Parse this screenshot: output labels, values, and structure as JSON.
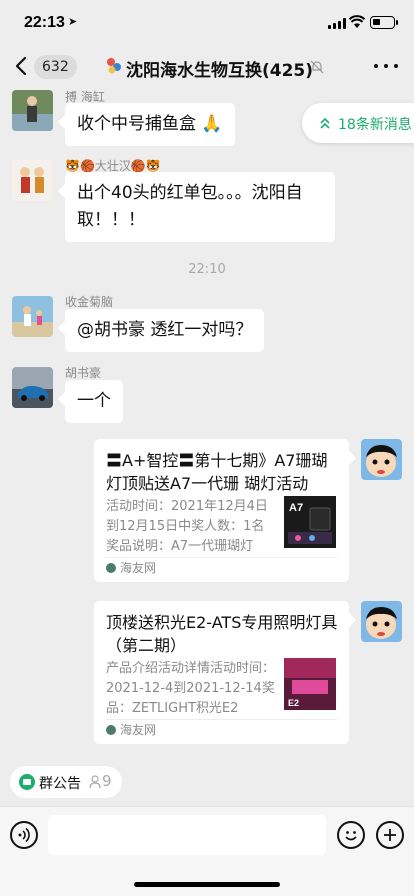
{
  "status": {
    "time": "22:13"
  },
  "nav": {
    "back_count": "632",
    "title": "沈阳海水生物互换(425)"
  },
  "new_messages": {
    "label": "18条新消息"
  },
  "messages": [
    {
      "sender": "搏 海缸",
      "text": "收个中号捕鱼盒 🙏"
    },
    {
      "sender": "🐯🏀大壮汉🏀🐯",
      "text": "出个40头的红单包。。。沈阳自取！！！"
    },
    {
      "sender": "收金菊脑",
      "text": "@胡书豪 透红一对吗？"
    },
    {
      "sender": "胡书豪",
      "text": "一个"
    }
  ],
  "time_divider": "22:10",
  "link_cards": [
    {
      "title": "〓A+智控〓第十七期》A7珊瑚灯顶贴送A7一代珊 瑚灯活动",
      "desc": "活动时间：2021年12月4日到12月15日中奖人数：1名奖品说明：A7一代珊瑚灯",
      "source": "海友网",
      "thumb_text": "A7"
    },
    {
      "title": "顶楼送积光E2-ATS专用照明灯具（第二期）",
      "desc": "产品介绍活动详情活动时间：2021-12-4到2021-12-14奖品：ZETLIGHT积光E2",
      "source": "海友网",
      "thumb_text": "E2"
    }
  ],
  "announcement": {
    "label": "群公告",
    "count": "9"
  },
  "colors": {
    "accent": "#1aad6e",
    "background": "#ededed"
  }
}
